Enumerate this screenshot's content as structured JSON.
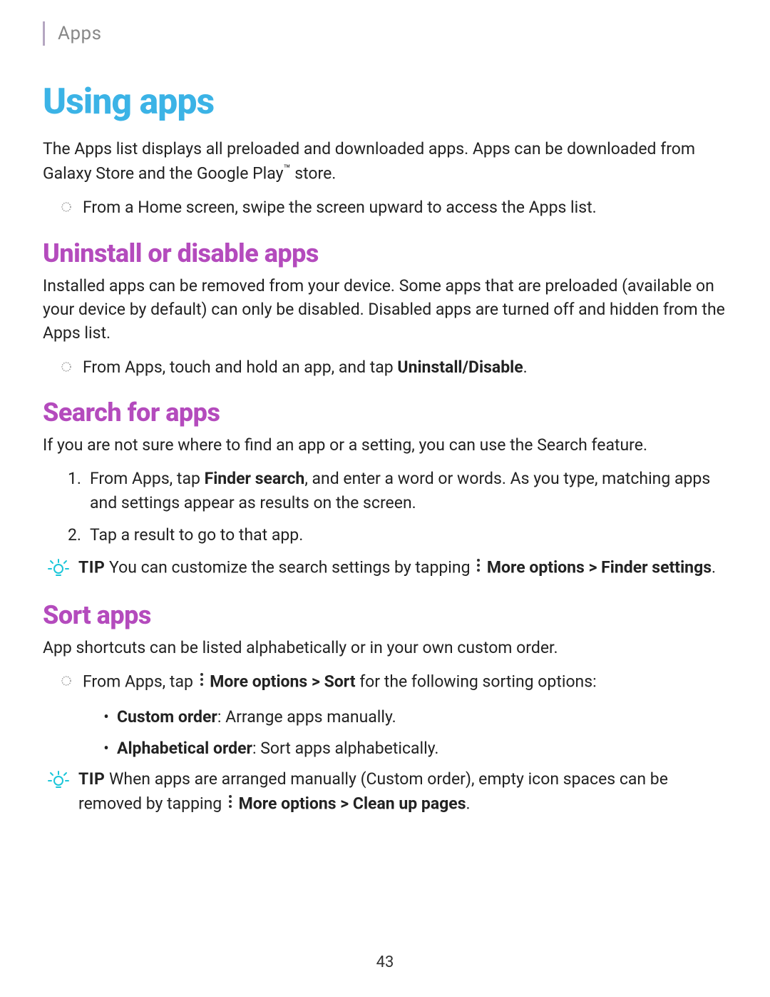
{
  "header": {
    "section": "Apps"
  },
  "h1": "Using apps",
  "intro_p1": "The Apps list displays all preloaded and downloaded apps. Apps can be downloaded from Galaxy Store and the Google Play",
  "intro_tm": "™",
  "intro_p2": " store.",
  "intro_bullet": "From a Home screen, swipe the screen upward to access the Apps list.",
  "sec1": {
    "title": "Uninstall or disable apps",
    "body": "Installed apps can be removed from your device. Some apps that are preloaded (available on your device by default) can only be disabled. Disabled apps are turned off and hidden from the Apps list.",
    "bullet_pre": "From Apps, touch and hold an app, and tap ",
    "bullet_bold": "Uninstall/Disable",
    "bullet_post": "."
  },
  "sec2": {
    "title": "Search for apps",
    "body": "If you are not sure where to find an app or a setting, you can use the Search feature.",
    "step1_pre": "From Apps, tap ",
    "step1_bold": "Finder search",
    "step1_post": ", and enter a word or words. As you type, matching apps and settings appear as results on the screen.",
    "step2": "Tap a result to go to that app.",
    "step1_num": "1.",
    "step2_num": "2.",
    "tip_label": "TIP",
    "tip_pre": "  You can customize the search settings by tapping ",
    "tip_bold1": "More options",
    "tip_mid": " > ",
    "tip_bold2": "Finder settings",
    "tip_post": "."
  },
  "sec3": {
    "title": "Sort apps",
    "body": "App shortcuts can be listed alphabetically or in your own custom order.",
    "bullet_pre": "From Apps, tap ",
    "bullet_bold1": "More options",
    "bullet_mid": " > ",
    "bullet_bold2": "Sort",
    "bullet_post": " for the following sorting options:",
    "sub1_bold": "Custom order",
    "sub1_post": ": Arrange apps manually.",
    "sub2_bold": "Alphabetical order",
    "sub2_post": ": Sort apps alphabetically.",
    "tip_label": "TIP",
    "tip_pre": "  When apps are arranged manually (Custom order), empty icon spaces can be removed by tapping ",
    "tip_bold1": "More options",
    "tip_mid": " > ",
    "tip_bold2": "Clean up pages",
    "tip_post": "."
  },
  "page_number": "43"
}
